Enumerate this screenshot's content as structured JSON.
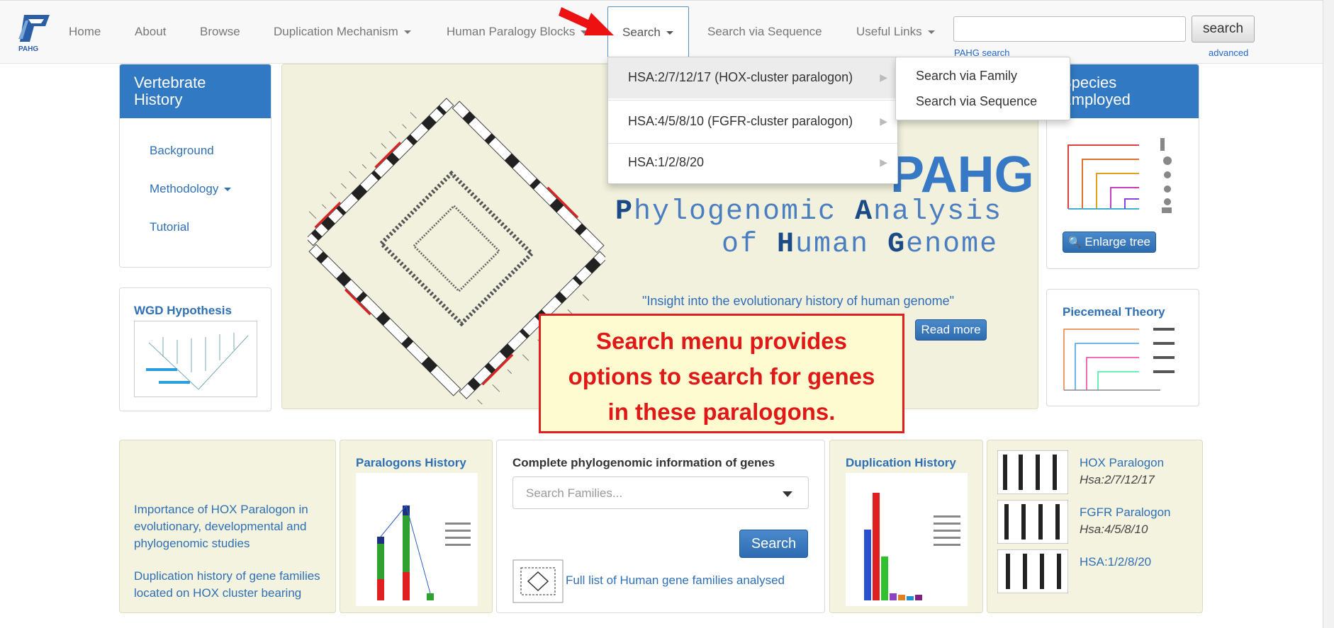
{
  "navbar": {
    "logo_text": "PAHG",
    "items": [
      {
        "label": "Home"
      },
      {
        "label": "About"
      },
      {
        "label": "Browse"
      },
      {
        "label": "Duplication Mechanism"
      },
      {
        "label": "Human Paralogy Blocks"
      },
      {
        "label": "Search"
      },
      {
        "label": "Search via Sequence"
      },
      {
        "label": "Useful Links"
      }
    ],
    "search_input_value": "",
    "search_button": "search",
    "pahg_search": "PAHG search",
    "advanced": "advanced"
  },
  "search_menu": {
    "items": [
      {
        "label": "HSA:2/7/12/17 (HOX-cluster paralogon)"
      },
      {
        "label": "HSA:4/5/8/10 (FGFR-cluster paralogon)"
      },
      {
        "label": "HSA:1/2/8/20"
      }
    ],
    "submenu": [
      {
        "label": "Search via Family"
      },
      {
        "label": "Search via Sequence"
      }
    ]
  },
  "left_panel": {
    "title_line1": "Vertebrate",
    "title_line2": "History",
    "links": [
      "Background",
      "Methodology",
      "Tutorial"
    ]
  },
  "wgd": {
    "title": "WGD Hypothesis"
  },
  "hero": {
    "title": "PAHG",
    "line1_rest": "hylogenomic ",
    "line1_caps": [
      "P",
      "A"
    ],
    "line1_rest2": "nalysis",
    "line2_pre": "of ",
    "line2_caps": [
      "H",
      "G"
    ],
    "line2_rest1": "uman ",
    "line2_rest2": "enome",
    "quote": "\"Insight into the evolutionary history of human genome\"",
    "read_more": "Read more"
  },
  "right_panel": {
    "title_line1": "Species",
    "title_line2": "Employed",
    "enlarge": "Enlarge tree"
  },
  "piecemeal": {
    "title": "Piecemeal Theory"
  },
  "annotation": {
    "lines": [
      "Search menu provides",
      "options to search for genes",
      "in these paralogons."
    ]
  },
  "bottom": {
    "left_text1": "Importance of HOX Paralogon in evolutionary, developmental and phylogenomic studies",
    "left_text2": "Duplication history of gene families located on HOX cluster bearing",
    "paralogons_history": "Paralogons History",
    "complete_info": "Complete phylogenomic information of genes",
    "search_families_placeholder": "Search Families...",
    "search_button": "Search",
    "full_list": "Full list of Human gene families analysed",
    "duplication_history": "Duplication History",
    "paralogons": [
      {
        "name": "HOX Paralogon",
        "sub": "Hsa:2/7/12/17"
      },
      {
        "name": "FGFR Paralogon",
        "sub": "Hsa:4/5/8/10"
      },
      {
        "name": "HSA:1/2/8/20",
        "sub": ""
      }
    ]
  },
  "colors": {
    "accent": "#3179c2",
    "annotation_red": "#e01818",
    "annotation_bg": "#fefbd0"
  }
}
